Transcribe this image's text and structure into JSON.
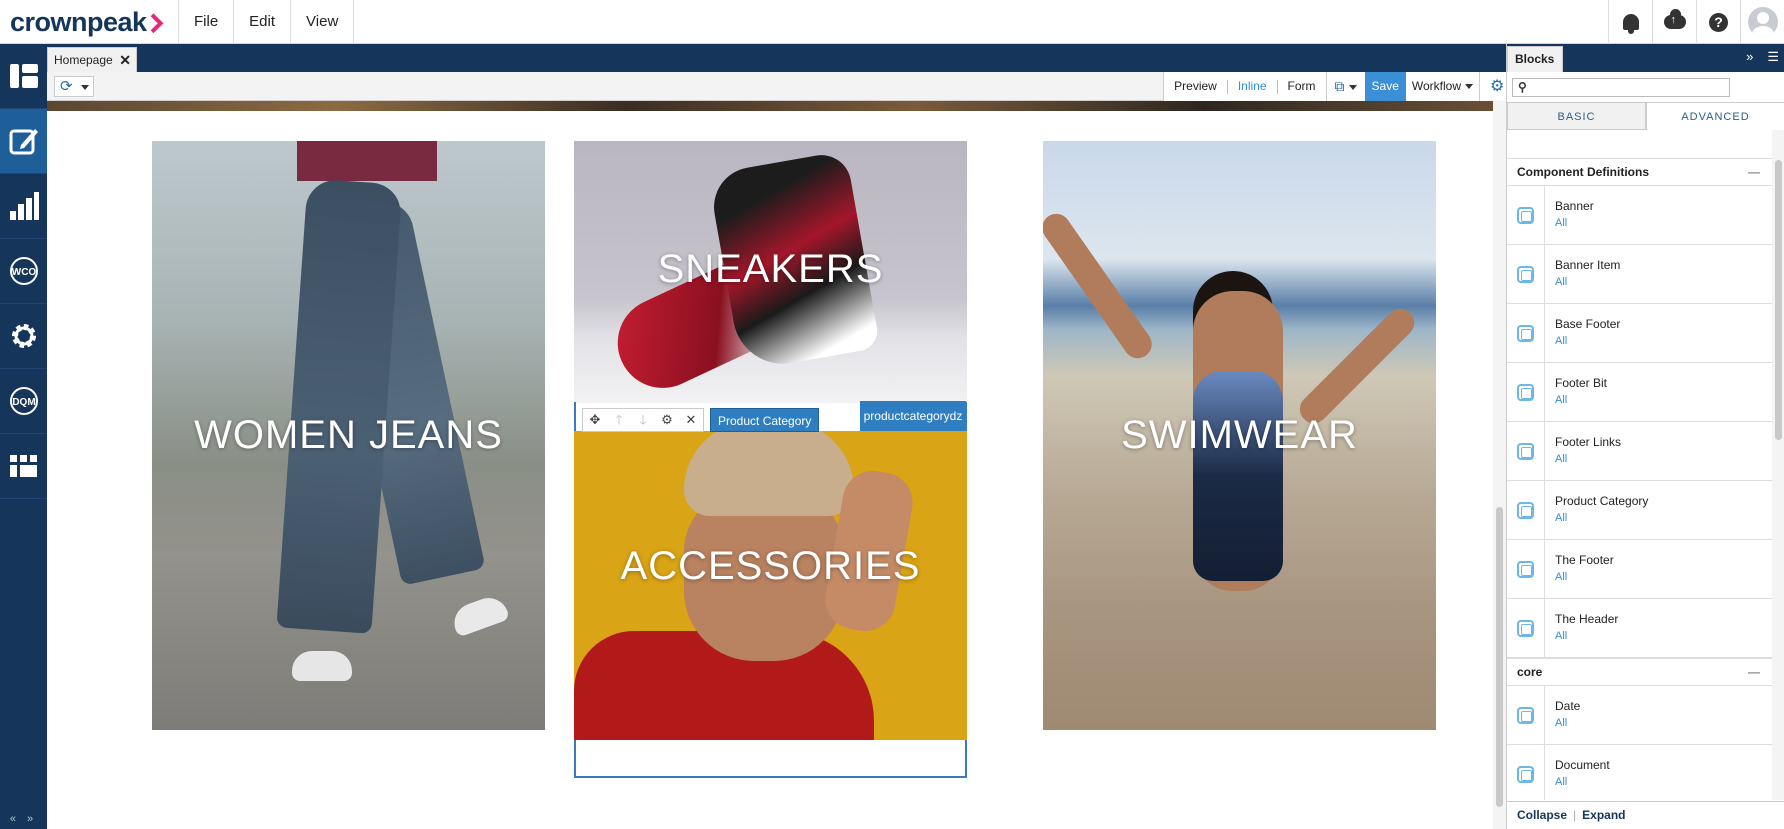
{
  "brand": {
    "name": "crownpeak"
  },
  "menu": [
    "File",
    "Edit",
    "View"
  ],
  "tab": {
    "label": "Homepage"
  },
  "toolbar": {
    "preview": "Preview",
    "inline": "Inline",
    "form": "Form",
    "save": "Save",
    "workflow": "Workflow"
  },
  "canvas": {
    "cards": {
      "women_jeans": "WOMEN JEANS",
      "sneakers": "SNEAKERS",
      "accessories": "ACCESSORIES",
      "swimwear": "SWIMWEAR"
    },
    "edit_bar": {
      "component_label": "Product Category"
    },
    "dropzone_tag": "productcategorydz"
  },
  "panel": {
    "title": "Blocks",
    "search": {
      "value": "",
      "placeholder": ""
    },
    "tabs": {
      "basic": "BASIC",
      "advanced": "ADVANCED"
    },
    "sections": [
      {
        "title": "Component Definitions",
        "items": [
          {
            "name": "Banner",
            "filter": "All"
          },
          {
            "name": "Banner Item",
            "filter": "All"
          },
          {
            "name": "Base Footer",
            "filter": "All"
          },
          {
            "name": "Footer Bit",
            "filter": "All"
          },
          {
            "name": "Footer Links",
            "filter": "All"
          },
          {
            "name": "Product Category",
            "filter": "All"
          },
          {
            "name": "The Footer",
            "filter": "All"
          },
          {
            "name": "The Header",
            "filter": "All"
          }
        ]
      },
      {
        "title": "core",
        "items": [
          {
            "name": "Date",
            "filter": "All"
          },
          {
            "name": "Document",
            "filter": "All"
          }
        ]
      }
    ],
    "footer": {
      "collapse": "Collapse",
      "expand": "Expand"
    }
  },
  "icons": {
    "topbar": [
      "bell-icon",
      "cloud-upload-icon",
      "help-icon",
      "avatar"
    ],
    "leftbar": [
      "dashboard-icon",
      "edit-icon",
      "analytics-icon",
      "wco-icon",
      "settings-icon",
      "dqm-icon",
      "apps-icon"
    ]
  },
  "colors": {
    "navy": "#15365a",
    "accent": "#2f7ec2",
    "brand_pink": "#e4287c",
    "link": "#2f8fd6"
  }
}
